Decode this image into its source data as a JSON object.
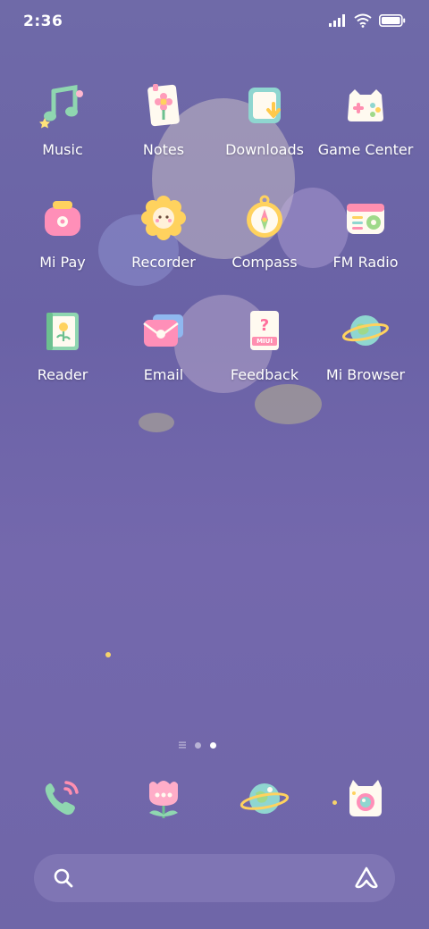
{
  "status_bar": {
    "time": "2:36"
  },
  "apps": [
    {
      "label": "Music",
      "icon": "music-note-icon"
    },
    {
      "label": "Notes",
      "icon": "notes-icon"
    },
    {
      "label": "Downloads",
      "icon": "downloads-icon"
    },
    {
      "label": "Game Center",
      "icon": "gamepad-icon"
    },
    {
      "label": "Mi Pay",
      "icon": "wallet-icon"
    },
    {
      "label": "Recorder",
      "icon": "flower-recorder-icon"
    },
    {
      "label": "Compass",
      "icon": "compass-icon"
    },
    {
      "label": "FM Radio",
      "icon": "radio-icon"
    },
    {
      "label": "Reader",
      "icon": "book-icon"
    },
    {
      "label": "Email",
      "icon": "email-icon"
    },
    {
      "label": "Feedback",
      "icon": "feedback-icon"
    },
    {
      "label": "Mi Browser",
      "icon": "planet-icon"
    }
  ],
  "feedback_badge": "MIUI",
  "dock": [
    {
      "icon": "phone-icon"
    },
    {
      "icon": "tulip-messages-icon"
    },
    {
      "icon": "planet-browser-icon"
    },
    {
      "icon": "cat-camera-icon"
    }
  ],
  "colors": {
    "wallpaper": "#6f6aa8",
    "label": "#ffffff",
    "search_bar": "#8c82be"
  }
}
